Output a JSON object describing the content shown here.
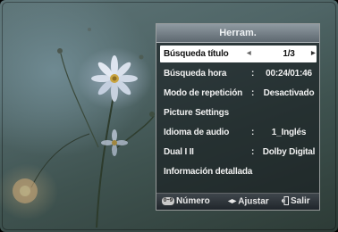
{
  "menu": {
    "title": "Herram.",
    "rows": [
      {
        "label": "Búsqueda título",
        "colon": "",
        "value": "1/3",
        "selected": true
      },
      {
        "label": "Búsqueda hora",
        "colon": ":",
        "value": "00:24/01:46"
      },
      {
        "label": "Modo de repetición",
        "colon": ":",
        "value": "Desactivado"
      },
      {
        "label": "Picture Settings",
        "colon": "",
        "value": ""
      },
      {
        "label": "Idioma de audio",
        "colon": ":",
        "value": "1_Inglés"
      },
      {
        "label": "Dual I II",
        "colon": ":",
        "value": "Dolby Digital"
      },
      {
        "label": "Información detallada",
        "colon": "",
        "value": ""
      }
    ]
  },
  "footer": {
    "number_badge": "0~9",
    "number_label": "Número",
    "adjust_label": "Ajustar",
    "exit_label": "Salir"
  },
  "icons": {
    "left": "left-triangle-icon",
    "right": "right-triangle-icon",
    "leftright": "left-right-arrows-icon",
    "exit": "exit-icon"
  },
  "colors": {
    "selection": "#ffffff",
    "panel": "#1a1e22",
    "title_bar": "#7b868d"
  }
}
